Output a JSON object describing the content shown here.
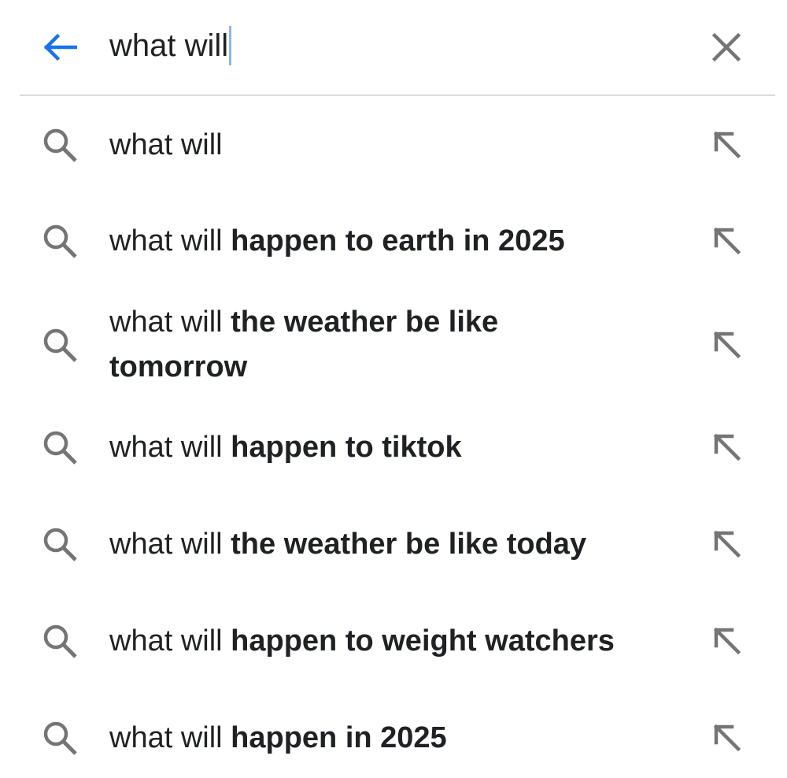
{
  "search": {
    "query": "what will",
    "caret_color": "#8ab4f8"
  },
  "icons": {
    "back": "back-arrow-icon",
    "clear": "close-icon",
    "suggestion": "search-icon",
    "fill": "arrow-up-left-icon"
  },
  "colors": {
    "accent": "#1a73e8",
    "icon_gray": "#757575",
    "text": "#202124",
    "divider": "#dadce0"
  },
  "suggestions": [
    {
      "prefix": "what will",
      "completion": ""
    },
    {
      "prefix": "what will ",
      "completion": "happen to earth in 2025"
    },
    {
      "prefix": "what will ",
      "completion": "the weather be like tomorrow"
    },
    {
      "prefix": "what will ",
      "completion": "happen to tiktok"
    },
    {
      "prefix": "what will ",
      "completion": "the weather be like today"
    },
    {
      "prefix": "what will ",
      "completion": "happen to weight watchers"
    },
    {
      "prefix": "what will ",
      "completion": "happen in 2025"
    }
  ]
}
